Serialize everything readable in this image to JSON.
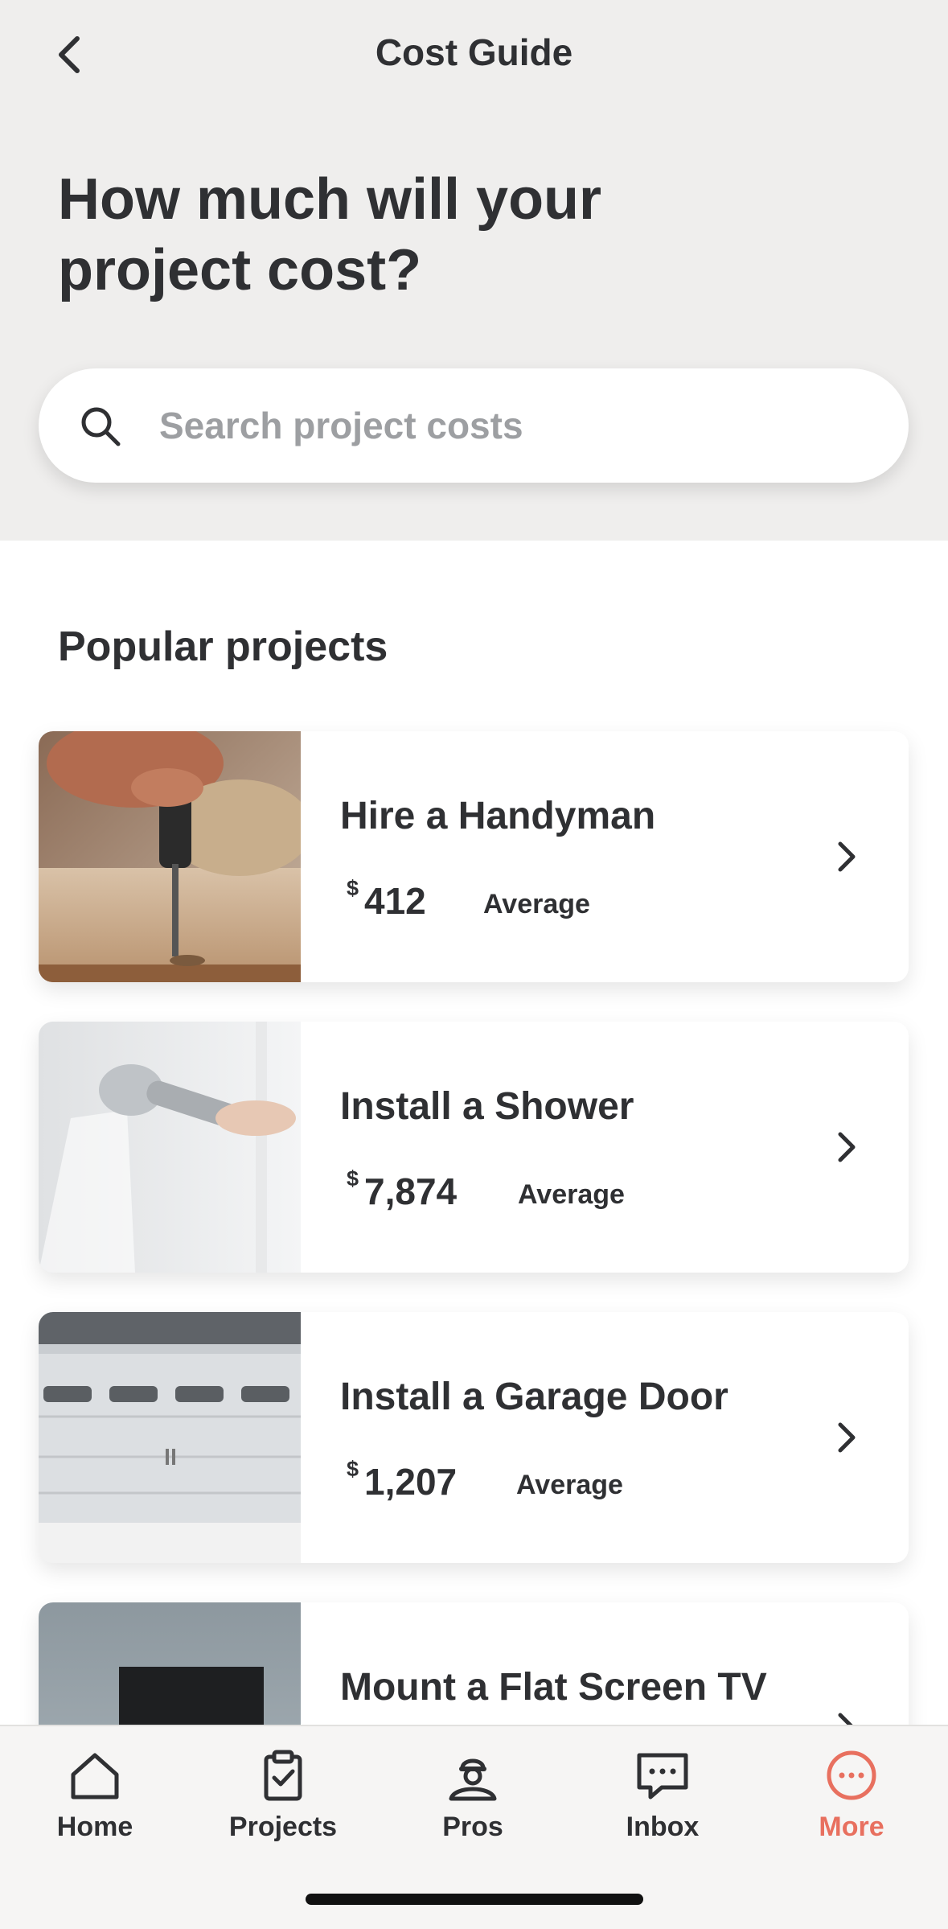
{
  "header": {
    "title": "Cost Guide",
    "headline_line1": "How much will your",
    "headline_line2": "project cost?"
  },
  "search": {
    "placeholder": "Search project costs"
  },
  "section": {
    "title": "Popular projects"
  },
  "projects": [
    {
      "title": "Hire a Handyman",
      "currency": "$",
      "amount": "412",
      "label": "Average"
    },
    {
      "title": "Install a Shower",
      "currency": "$",
      "amount": "7,874",
      "label": "Average"
    },
    {
      "title": "Install a Garage Door",
      "currency": "$",
      "amount": "1,207",
      "label": "Average"
    },
    {
      "title": "Mount a Flat Screen TV"
    }
  ],
  "tabs": [
    {
      "label": "Home",
      "icon": "home-icon"
    },
    {
      "label": "Projects",
      "icon": "clipboard-icon"
    },
    {
      "label": "Pros",
      "icon": "pro-person-icon"
    },
    {
      "label": "Inbox",
      "icon": "chat-icon"
    },
    {
      "label": "More",
      "icon": "more-icon",
      "active": true
    }
  ],
  "colors": {
    "accent": "#e8705f",
    "text": "#2f3033",
    "header_bg": "#efeeed",
    "placeholder": "#9d9fa2"
  }
}
